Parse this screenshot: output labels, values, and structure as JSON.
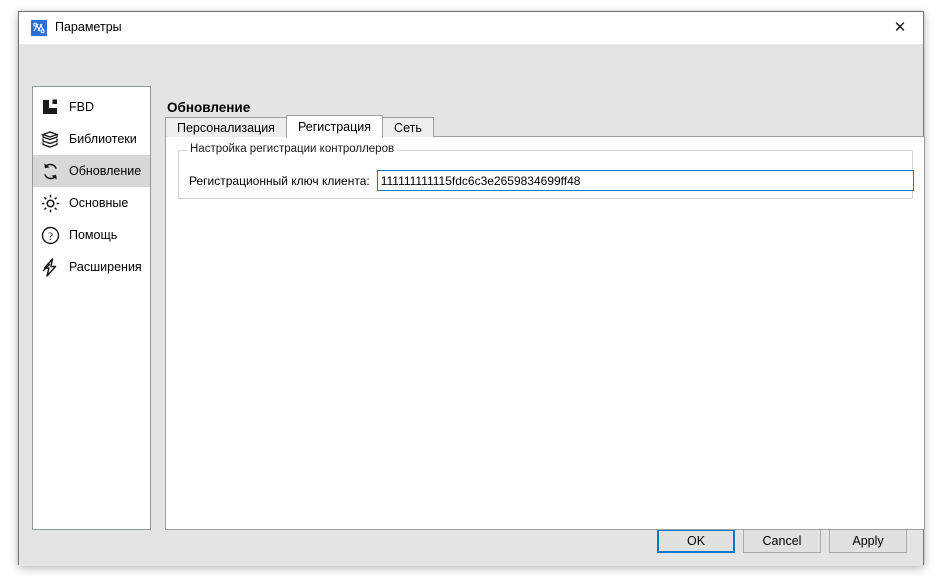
{
  "window": {
    "title": "Параметры",
    "icon": "app-icon",
    "close_label": "✕"
  },
  "sidebar": {
    "items": [
      {
        "label": "FBD",
        "icon": "fbd-icon",
        "selected": false
      },
      {
        "label": "Библиотеки",
        "icon": "library-icon",
        "selected": false
      },
      {
        "label": "Обновление",
        "icon": "refresh-icon",
        "selected": true
      },
      {
        "label": "Основные",
        "icon": "gear-icon",
        "selected": false
      },
      {
        "label": "Помощь",
        "icon": "help-icon",
        "selected": false
      },
      {
        "label": "Расширения",
        "icon": "lightning-icon",
        "selected": false
      }
    ]
  },
  "content": {
    "section_title": "Обновление",
    "tabs": [
      {
        "label": "Персонализация",
        "active": false
      },
      {
        "label": "Регистрация",
        "active": true
      },
      {
        "label": "Сеть",
        "active": false
      }
    ],
    "group": {
      "legend": "Настройка регистрации контроллеров",
      "field_label": "Регистрационный ключ клиента:",
      "field_value": "111111111115fdc6c3e2659834699ff48",
      "field_placeholder": ""
    }
  },
  "footer": {
    "ok_label": "OK",
    "cancel_label": "Cancel",
    "apply_label": "Apply"
  },
  "colors": {
    "dialog_background": "#e4e4e4",
    "panel_background": "#ffffff",
    "accent_focus": "#0a7ac4",
    "selection_highlight": "#d8d8d8",
    "border": "#a0a0a0"
  }
}
